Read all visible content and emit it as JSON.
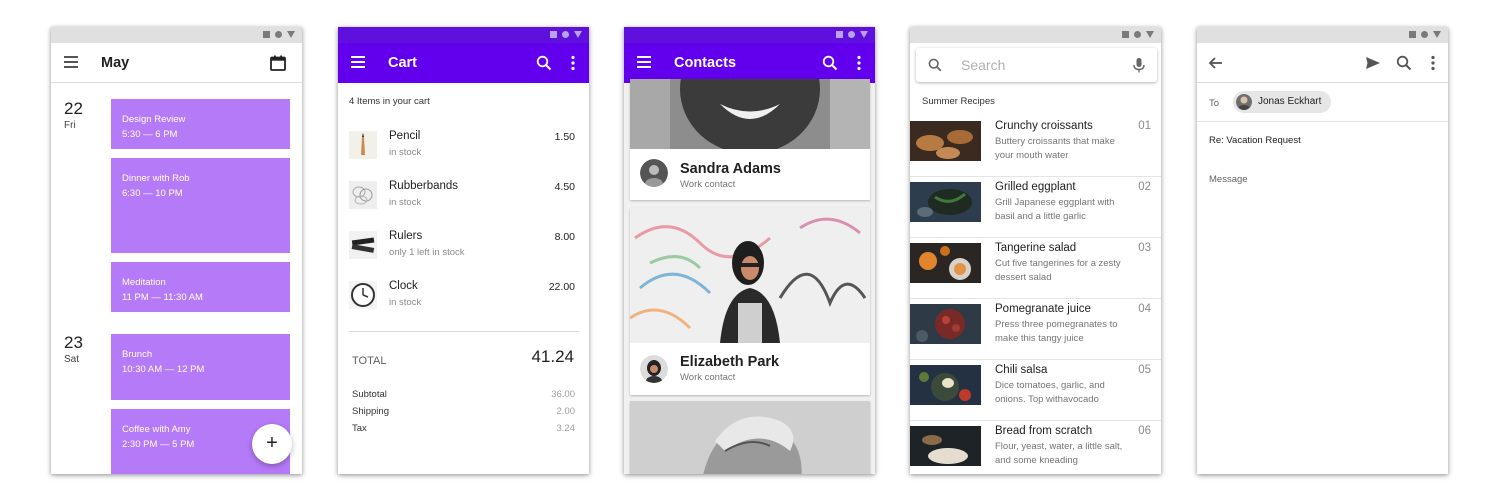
{
  "calendar": {
    "title": "May",
    "days": [
      {
        "num": "22",
        "dow": "Fri"
      },
      {
        "num": "23",
        "dow": "Sat"
      }
    ],
    "events": [
      {
        "title": "Design Review",
        "time": "5:30 — 6 PM"
      },
      {
        "title": "Dinner with Rob",
        "time": "6:30 — 10 PM"
      },
      {
        "title": "Meditation",
        "time": "11 PM — 11:30 AM"
      },
      {
        "title": "Brunch",
        "time": "10:30 AM — 12 PM"
      },
      {
        "title": "Coffee with Amy",
        "time": "2:30 PM — 5 PM"
      }
    ],
    "fab_label": "+",
    "event_color": "#b57af8"
  },
  "cart": {
    "title": "Cart",
    "count_text": "4 Items in your cart",
    "items": [
      {
        "name": "Pencil",
        "stock": "in stock",
        "price": "1.50"
      },
      {
        "name": "Rubberbands",
        "stock": "in stock",
        "price": "4.50"
      },
      {
        "name": "Rulers",
        "stock": "only 1 left in stock",
        "price": "8.00"
      },
      {
        "name": "Clock",
        "stock": "in stock",
        "price": "22.00"
      }
    ],
    "total_label": "TOTAL",
    "total_value": "41.24",
    "summary": [
      {
        "label": "Subtotal",
        "value": "36.00"
      },
      {
        "label": "Shipping",
        "value": "2.00"
      },
      {
        "label": "Tax",
        "value": "3.24"
      }
    ]
  },
  "contacts": {
    "title": "Contacts",
    "cards": [
      {
        "name": "Sandra Adams",
        "subtitle": "Work contact"
      },
      {
        "name": "Elizabeth Park",
        "subtitle": "Work contact"
      }
    ],
    "app_bar_color": "#6200ee"
  },
  "recipes": {
    "search_placeholder": "Search",
    "section_title": "Summer Recipes",
    "items": [
      {
        "title": "Crunchy croissants",
        "desc": "Buttery croissants that make your mouth water",
        "num": "01"
      },
      {
        "title": "Grilled eggplant",
        "desc": "Grill Japanese eggplant with basil and a little garlic",
        "num": "02"
      },
      {
        "title": "Tangerine salad",
        "desc": "Cut five tangerines for a zesty dessert salad",
        "num": "03"
      },
      {
        "title": "Pomegranate juice",
        "desc": "Press three pomegranates to make this tangy juice",
        "num": "04"
      },
      {
        "title": "Chili salsa",
        "desc": "Dice tomatoes, garlic, and onions. Top withavocado",
        "num": "05"
      },
      {
        "title": "Bread from scratch",
        "desc": "Flour, yeast, water, a little salt, and some kneading",
        "num": "06"
      }
    ]
  },
  "email": {
    "to_label": "To",
    "recipient": "Jonas Eckhart",
    "subject": "Re: Vacation Request",
    "message_placeholder": "Message"
  }
}
